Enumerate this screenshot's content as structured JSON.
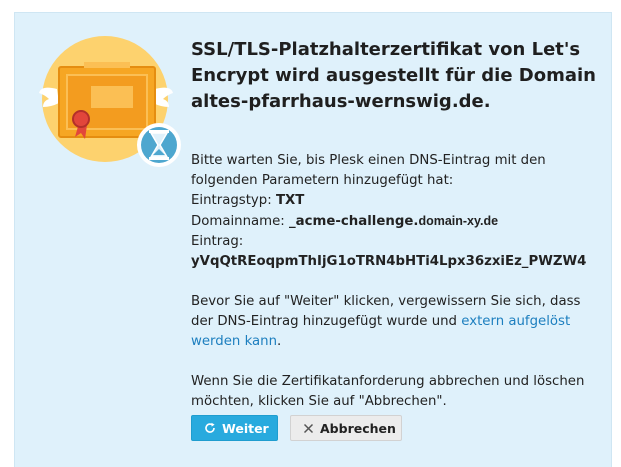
{
  "dialog": {
    "title_lines": [
      "SSL/TLS-Platzhalterzertifikat von Let's",
      "Encrypt wird ausgestellt für die Domain",
      "altes-pfarrhaus-wernswig.de."
    ],
    "intro_line1": "Bitte warten Sie, bis Plesk einen DNS-Eintrag mit den",
    "intro_line2": "folgenden Parametern hinzugefügt hat:",
    "record_type_label": "Eintragstyp:",
    "record_type_value": "TXT",
    "domain_name_label": "Domainname:",
    "domain_name_value_part1": "_acme-challenge.",
    "domain_name_value_part2": "domain-xy.de",
    "entry_label": "Eintrag:",
    "entry_value": "yVqQtREoqpmThIjG1oTRN4bHTi4Lpx36zxiEz_PWZW4",
    "confirm_line1": "Bevor Sie auf \"Weiter\" klicken, vergewissern Sie sich, dass",
    "confirm_line2_prefix": "der DNS-Eintrag hinzugefügt wurde und",
    "confirm_link": "extern aufgelöst",
    "confirm_link_line2": "werden kann",
    "confirm_suffix": ".",
    "cancel_line1": "Wenn Sie die Zertifikatanforderung abbrechen und löschen",
    "cancel_line2": "möchten, klicken Sie auf \"Abbrechen\"."
  },
  "buttons": {
    "continue_label": "Weiter",
    "cancel_label": "Abbrechen"
  },
  "colors": {
    "panel_bg": "#dff1fb",
    "accent": "#28aade",
    "link": "#1d7fbf",
    "certificate": "#f6a623",
    "circle": "#fdd26e"
  },
  "icons": {
    "illustration": "certificate-hourglass-icon",
    "continue": "refresh-icon",
    "cancel": "close-icon"
  }
}
